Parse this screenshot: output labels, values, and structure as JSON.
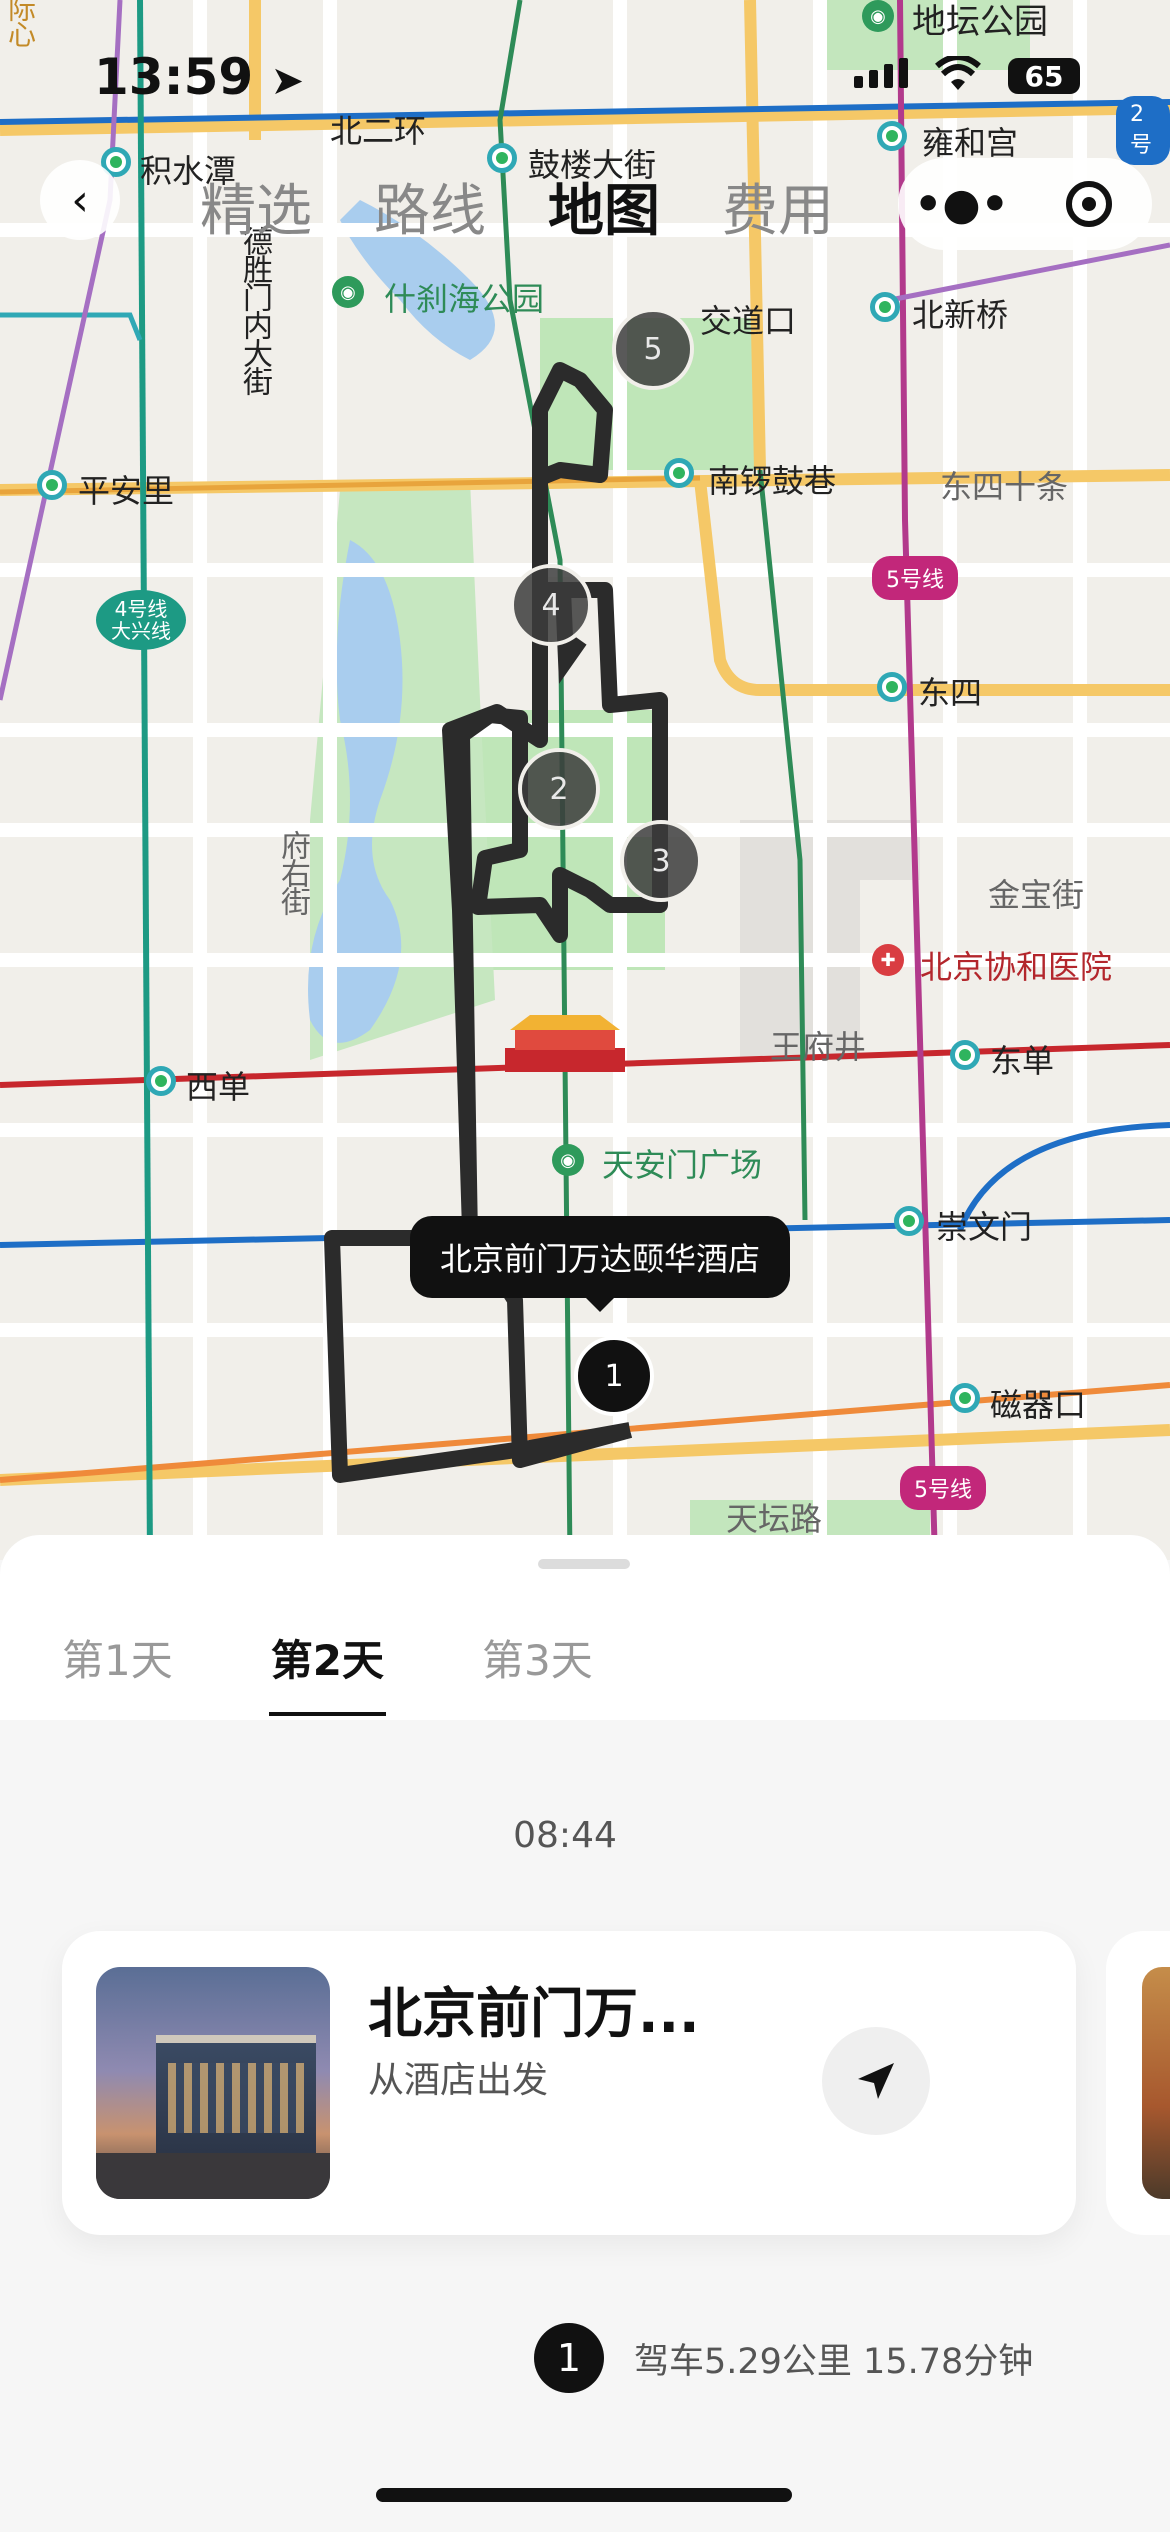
{
  "status_bar": {
    "time": "13:59",
    "battery": "65"
  },
  "top_nav": {
    "tabs": [
      "精选",
      "路线",
      "地图",
      "费用"
    ],
    "active_tab": "地图",
    "more_icon": "more-dots-icon",
    "target_icon": "target-icon"
  },
  "map": {
    "labels": {
      "l1": "地坛公园",
      "l2": "北二环",
      "l3": "积水潭",
      "l4": "鼓楼大街",
      "l5": "雍和宫",
      "l6": "什刹海公园",
      "l7": "交道口",
      "l8": "北新桥",
      "l9": "德胜门内大街",
      "l10": "平安里",
      "l11": "南锣鼓巷",
      "l12": "东四十条",
      "l13": "东四",
      "l14": "府右街",
      "l15": "金宝街",
      "l16": "北京协和医院",
      "l17": "王府井",
      "l18": "东单",
      "l19": "西单",
      "l20": "天安门广场",
      "l21": "崇文门",
      "l22": "磁器口",
      "l23": "天坛路",
      "l24": "际心"
    },
    "badges": {
      "line5a": "5号线",
      "line5b": "5号线",
      "line4": "4号线\n大兴线",
      "line2": "2号"
    },
    "pins": [
      "1",
      "2",
      "3",
      "4",
      "5"
    ],
    "active_pin": "1",
    "tooltip": "北京前门万达颐华酒店"
  },
  "day_tabs": [
    "第1天",
    "第2天",
    "第3天"
  ],
  "active_day": "第2天",
  "schedule": {
    "time": "08:44",
    "card": {
      "title": "北京前门万...",
      "subtitle": "从酒店出发"
    },
    "route": {
      "number": "1",
      "text": "驾车5.29公里 15.78分钟"
    }
  }
}
